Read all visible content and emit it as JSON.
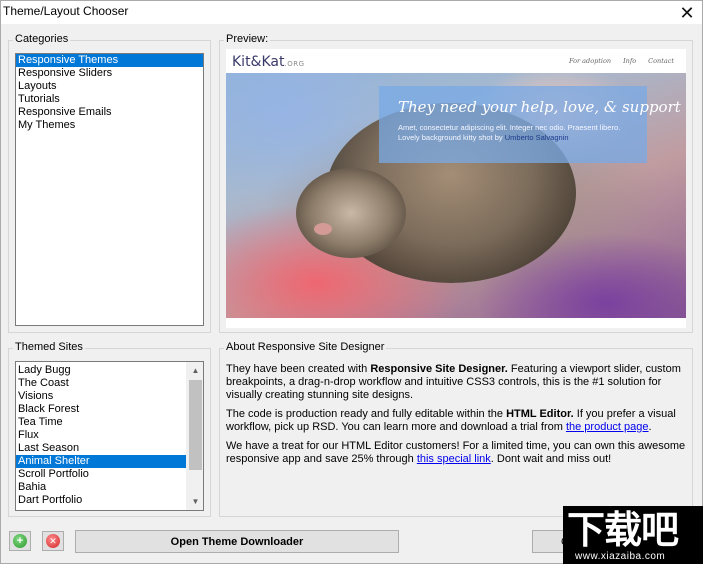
{
  "window": {
    "title": "Theme/Layout Chooser"
  },
  "categories": {
    "label": "Categories",
    "items": [
      {
        "label": "Responsive Themes",
        "selected": true
      },
      {
        "label": "Responsive Sliders",
        "selected": false
      },
      {
        "label": "Layouts",
        "selected": false
      },
      {
        "label": "Tutorials",
        "selected": false
      },
      {
        "label": "Responsive Emails",
        "selected": false
      },
      {
        "label": "My Themes",
        "selected": false
      }
    ]
  },
  "preview": {
    "label": "Preview:",
    "site_logo": "Kit&Kat",
    "site_logo_suffix": ".ORG",
    "nav": [
      "For adoption",
      "Info",
      "Contact"
    ],
    "hero_title": "They need your help, love, & support",
    "hero_text": "Amet, consectetur adipiscing elit. Integer nec odio. Praesent libero. Lovely background kitty shot by ",
    "hero_credit": "Umberto Salvagnin"
  },
  "themed_sites": {
    "label": "Themed Sites",
    "items": [
      {
        "label": "Lady Bugg",
        "selected": false
      },
      {
        "label": "The Coast",
        "selected": false
      },
      {
        "label": "Visions",
        "selected": false
      },
      {
        "label": "Black Forest",
        "selected": false
      },
      {
        "label": "Tea Time",
        "selected": false
      },
      {
        "label": "Flux",
        "selected": false
      },
      {
        "label": "Last Season",
        "selected": false
      },
      {
        "label": "Animal Shelter",
        "selected": true
      },
      {
        "label": "Scroll Portfolio",
        "selected": false
      },
      {
        "label": "Bahia",
        "selected": false
      },
      {
        "label": "Dart Portfolio",
        "selected": false
      }
    ]
  },
  "about": {
    "label": "About Responsive Site Designer",
    "p1_pre": "They have been created with ",
    "p1_bold": "Responsive Site Designer.",
    "p1_post": " Featuring a viewport slider, custom breakpoints, a drag-n-drop workflow and intuitive CSS3 controls, this is the #1 solution for visually creating stunning site designs.",
    "p2_pre": "The code is production ready and fully editable within the ",
    "p2_bold": "HTML Editor.",
    "p2_mid": " If you prefer a visual workflow, pick up RSD. You can learn more and download a trial from ",
    "p2_link": "the product page",
    "p2_post": ".",
    "p3_pre": "We have a treat for our HTML Editor customers! For a limited time, you can own this awesome responsive app and save 25% through ",
    "p3_link": "this special link",
    "p3_post": ". Dont wait and miss out!"
  },
  "buttons": {
    "add_icon": "plus-circle-icon",
    "remove_icon": "remove-circle-icon",
    "open_downloader": "Open Theme Downloader",
    "ok_partial": "O"
  },
  "watermark": {
    "main": "下载吧",
    "url": "www.xiazaiba.com"
  }
}
